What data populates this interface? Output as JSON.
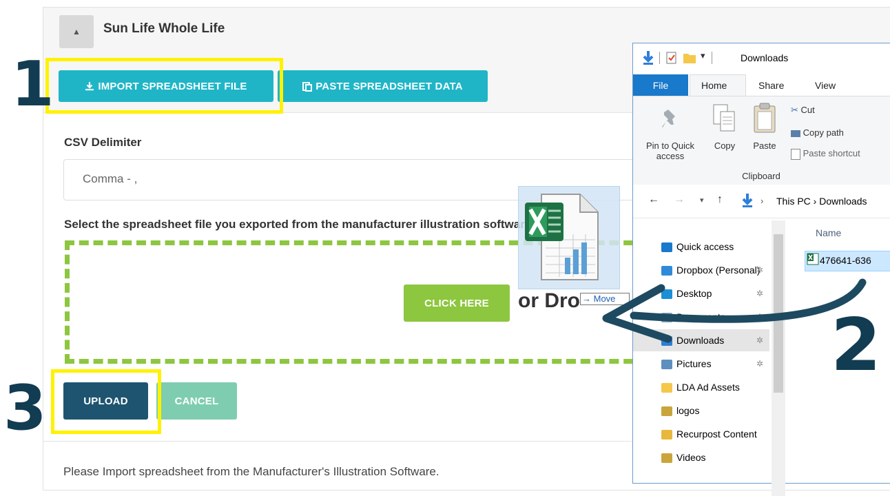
{
  "panel": {
    "title": "Sun Life Whole Life",
    "import_label": "IMPORT SPREADSHEET FILE",
    "paste_label": "PASTE SPREADSHEET DATA",
    "delimiter_label": "CSV Delimiter",
    "delimiter_value": "Comma - ,",
    "select_file_label": "Select the spreadsheet file you exported from the manufacturer illustration software",
    "click_here_label": "CLICK HERE",
    "drop_text": "or Drop",
    "upload_label": "UPLOAD",
    "cancel_label": "CANCEL",
    "footer_text": "Please Import spreadsheet from the Manufacturer's Illustration Software."
  },
  "steps": {
    "one": "1",
    "two": "2",
    "three": "3"
  },
  "explorer": {
    "title": "Downloads",
    "tabs": {
      "file": "File",
      "home": "Home",
      "share": "Share",
      "view": "View"
    },
    "ribbon": {
      "pin": "Pin to Quick access",
      "copy": "Copy",
      "paste": "Paste",
      "cut": "Cut",
      "copy_path": "Copy path",
      "paste_shortcut": "Paste shortcut",
      "group": "Clipboard"
    },
    "address": "This PC  ›  Downloads",
    "column_name": "Name",
    "file_name": "476641-636",
    "nav": [
      {
        "label": "Quick access",
        "icon": "star-icon",
        "color": "#1979ca"
      },
      {
        "label": "Dropbox (Personal)",
        "icon": "dropbox-icon",
        "color": "#2f8bd9"
      },
      {
        "label": "Desktop",
        "icon": "desktop-icon",
        "color": "#1c8fd6"
      },
      {
        "label": "Documents",
        "icon": "documents-icon",
        "color": "#8aa4be"
      },
      {
        "label": "Downloads",
        "icon": "download-icon",
        "color": "#2f7ed8"
      },
      {
        "label": "Pictures",
        "icon": "pictures-icon",
        "color": "#5e8fbf"
      },
      {
        "label": "LDA Ad Assets",
        "icon": "folder-icon",
        "color": "#f4c84a"
      },
      {
        "label": "logos",
        "icon": "folder-users-icon",
        "color": "#c9a53c"
      },
      {
        "label": "Recurpost Content",
        "icon": "folder-shared-icon",
        "color": "#e8b83c"
      },
      {
        "label": "Videos",
        "icon": "folder-users-icon",
        "color": "#c9a53c"
      }
    ]
  },
  "drag": {
    "tooltip": "→ Move"
  },
  "colors": {
    "teal": "#1fb5c7",
    "green": "#8dc63f",
    "navy": "#1e5470",
    "mint": "#7fcdb1",
    "highlight": "#fff200",
    "step": "#123c52"
  }
}
